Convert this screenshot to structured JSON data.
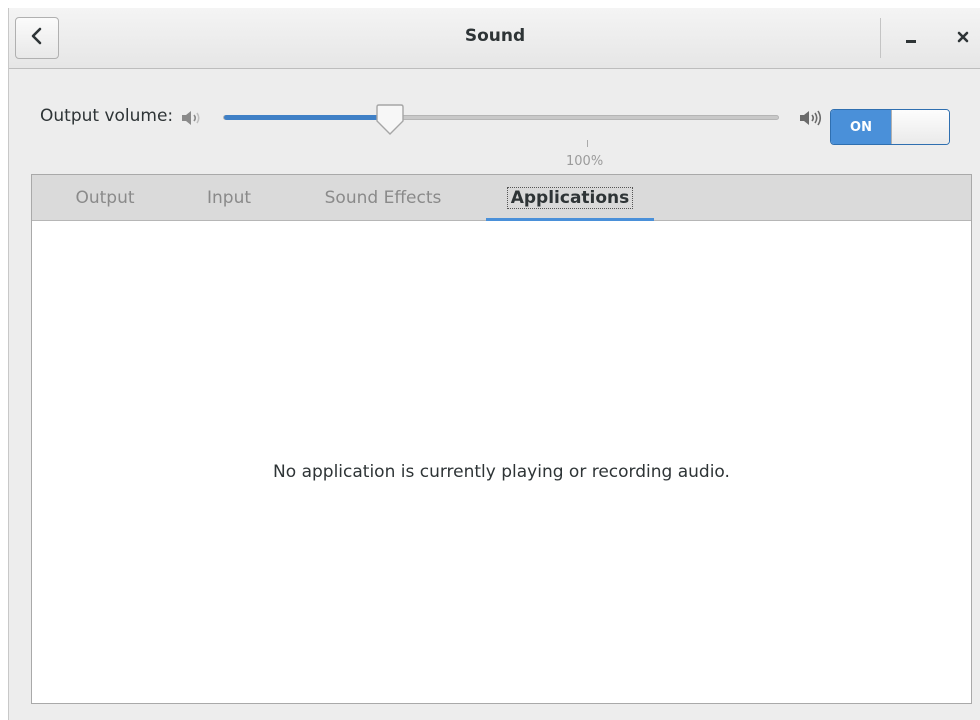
{
  "window": {
    "title": "Sound"
  },
  "volume": {
    "label": "Output volume:",
    "level_fraction": 0.3,
    "mark_label": "100%",
    "switch_label": "ON",
    "switch_state": "on"
  },
  "tabs": [
    {
      "label": "Output",
      "active": false
    },
    {
      "label": "Input",
      "active": false
    },
    {
      "label": "Sound Effects",
      "active": false
    },
    {
      "label": "Applications",
      "active": true
    }
  ],
  "applications": {
    "empty_message": "No application is currently playing or recording audio."
  },
  "colors": {
    "accent": "#4a90d9",
    "slider_fill": "#3f80c6",
    "background": "#ededed"
  },
  "icons": {
    "back": "chevron-left-icon",
    "minimize": "minimize-icon",
    "close": "close-icon",
    "volume_low": "speaker-low-icon",
    "volume_high": "speaker-high-icon"
  }
}
